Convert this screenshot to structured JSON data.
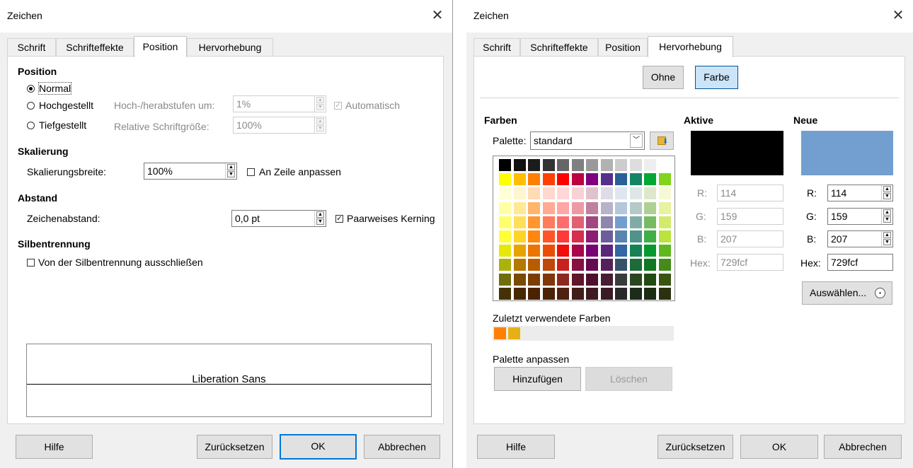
{
  "left": {
    "title": "Zeichen",
    "tabs": [
      "Schrift",
      "Schrifteffekte",
      "Position",
      "Hervorhebung"
    ],
    "position": {
      "heading": "Position",
      "normal": "Normal",
      "hochgestellt": "Hochgestellt",
      "tiefgestellt": "Tiefgestellt",
      "raise_label": "Hoch-/herabstufen um:",
      "raise_value": "1%",
      "auto_label": "Automatisch",
      "rel_size_label": "Relative Schriftgröße:",
      "rel_size_value": "100%"
    },
    "scaling": {
      "heading": "Skalierung",
      "width_label": "Skalierungsbreite:",
      "width_value": "100%",
      "fit_line": "An Zeile anpassen"
    },
    "spacing": {
      "heading": "Abstand",
      "char_label": "Zeichenabstand:",
      "char_value": "0,0 pt",
      "kerning": "Paarweises Kerning"
    },
    "hyphen": {
      "heading": "Silbentrennung",
      "exclude": "Von der Silbentrennung ausschließen"
    },
    "preview_text": "Liberation Sans",
    "buttons": {
      "help": "Hilfe",
      "reset": "Zurücksetzen",
      "ok": "OK",
      "cancel": "Abbrechen"
    }
  },
  "right": {
    "title": "Zeichen",
    "tabs": [
      "Schrift",
      "Schrifteffekte",
      "Position",
      "Hervorhebung"
    ],
    "toggle": {
      "none": "Ohne",
      "color": "Farbe"
    },
    "farben": "Farben",
    "palette_label": "Palette:",
    "palette_value": "standard",
    "recent_label": "Zuletzt verwendete Farben",
    "recent_colors": [
      "#ff8000",
      "#e6b117"
    ],
    "palette_edit_label": "Palette anpassen",
    "add_button": "Hinzufügen",
    "delete_button": "Löschen",
    "active": {
      "heading": "Aktive",
      "color": "#000000",
      "r_label": "R:",
      "g_label": "G:",
      "b_label": "B:",
      "hex_label": "Hex:",
      "r": "114",
      "g": "159",
      "b": "207",
      "hex": "729fcf"
    },
    "new": {
      "heading": "Neue",
      "color": "#729fcf",
      "r_label": "R:",
      "g_label": "G:",
      "b_label": "B:",
      "hex_label": "Hex:",
      "r": "114",
      "g": "159",
      "b": "207",
      "hex": "729fcf"
    },
    "choose_button": "Auswählen...",
    "buttons": {
      "help": "Hilfe",
      "reset": "Zurücksetzen",
      "ok": "OK",
      "cancel": "Abbrechen"
    }
  },
  "palette_colors": [
    [
      "#000000",
      "#111111",
      "#1c1c1c",
      "#333333",
      "#666666",
      "#808080",
      "#999999",
      "#b2b2b2",
      "#cccccc",
      "#dddddd",
      "#eeeeee",
      "#ffffff"
    ],
    [
      "#ffff00",
      "#ffbf00",
      "#ff8000",
      "#ff4000",
      "#ff0000",
      "#bf0041",
      "#800080",
      "#55308d",
      "#2a6099",
      "#158466",
      "#00a933",
      "#81d41a"
    ],
    [
      "#ffffd7",
      "#fff5ce",
      "#ffdbb6",
      "#ffd8ce",
      "#ffd7d7",
      "#f7d1d5",
      "#e0c2cd",
      "#dedce6",
      "#dee6ef",
      "#dee7e5",
      "#dde8cb",
      "#f6f9d4"
    ],
    [
      "#ffffa6",
      "#ffe994",
      "#ffb66c",
      "#ffaa95",
      "#ffa6a6",
      "#ec9ba4",
      "#bf819e",
      "#b7b3ca",
      "#b4c7dc",
      "#b3cac7",
      "#afd095",
      "#e8f2a1"
    ],
    [
      "#ffff6d",
      "#ffde59",
      "#ff972f",
      "#ff7b59",
      "#ff6d6d",
      "#e16173",
      "#a1467e",
      "#8e86ae",
      "#729fcf",
      "#81aca6",
      "#77bc65",
      "#d4ea6b"
    ],
    [
      "#ffff38",
      "#ffd428",
      "#ff860d",
      "#ff5429",
      "#ff3838",
      "#d62e4e",
      "#8d1d75",
      "#6b5e9b",
      "#5983b0",
      "#50938a",
      "#3faf46",
      "#bbe33d"
    ],
    [
      "#e6e905",
      "#e8a202",
      "#ea7500",
      "#ed4c05",
      "#f10d0c",
      "#a7074b",
      "#780373",
      "#5b277d",
      "#3465a4",
      "#168253",
      "#069a2e",
      "#5eb91e"
    ],
    [
      "#acb20c",
      "#b47804",
      "#b85c00",
      "#be480a",
      "#c9211e",
      "#861141",
      "#650953",
      "#55215b",
      "#355269",
      "#1e6a39",
      "#127622",
      "#468a1a"
    ],
    [
      "#706e0c",
      "#784b04",
      "#7b3d00",
      "#813709",
      "#8d281e",
      "#611729",
      "#4e102d",
      "#481d32",
      "#383d3c",
      "#28471f",
      "#224b12",
      "#395511"
    ],
    [
      "#443205",
      "#472702",
      "#492300",
      "#4b2204",
      "#50200f",
      "#421d1a",
      "#3d1b20",
      "#3a1b25",
      "#29292b",
      "#1d2b1a",
      "#1b2d12",
      "#2b3110"
    ]
  ]
}
